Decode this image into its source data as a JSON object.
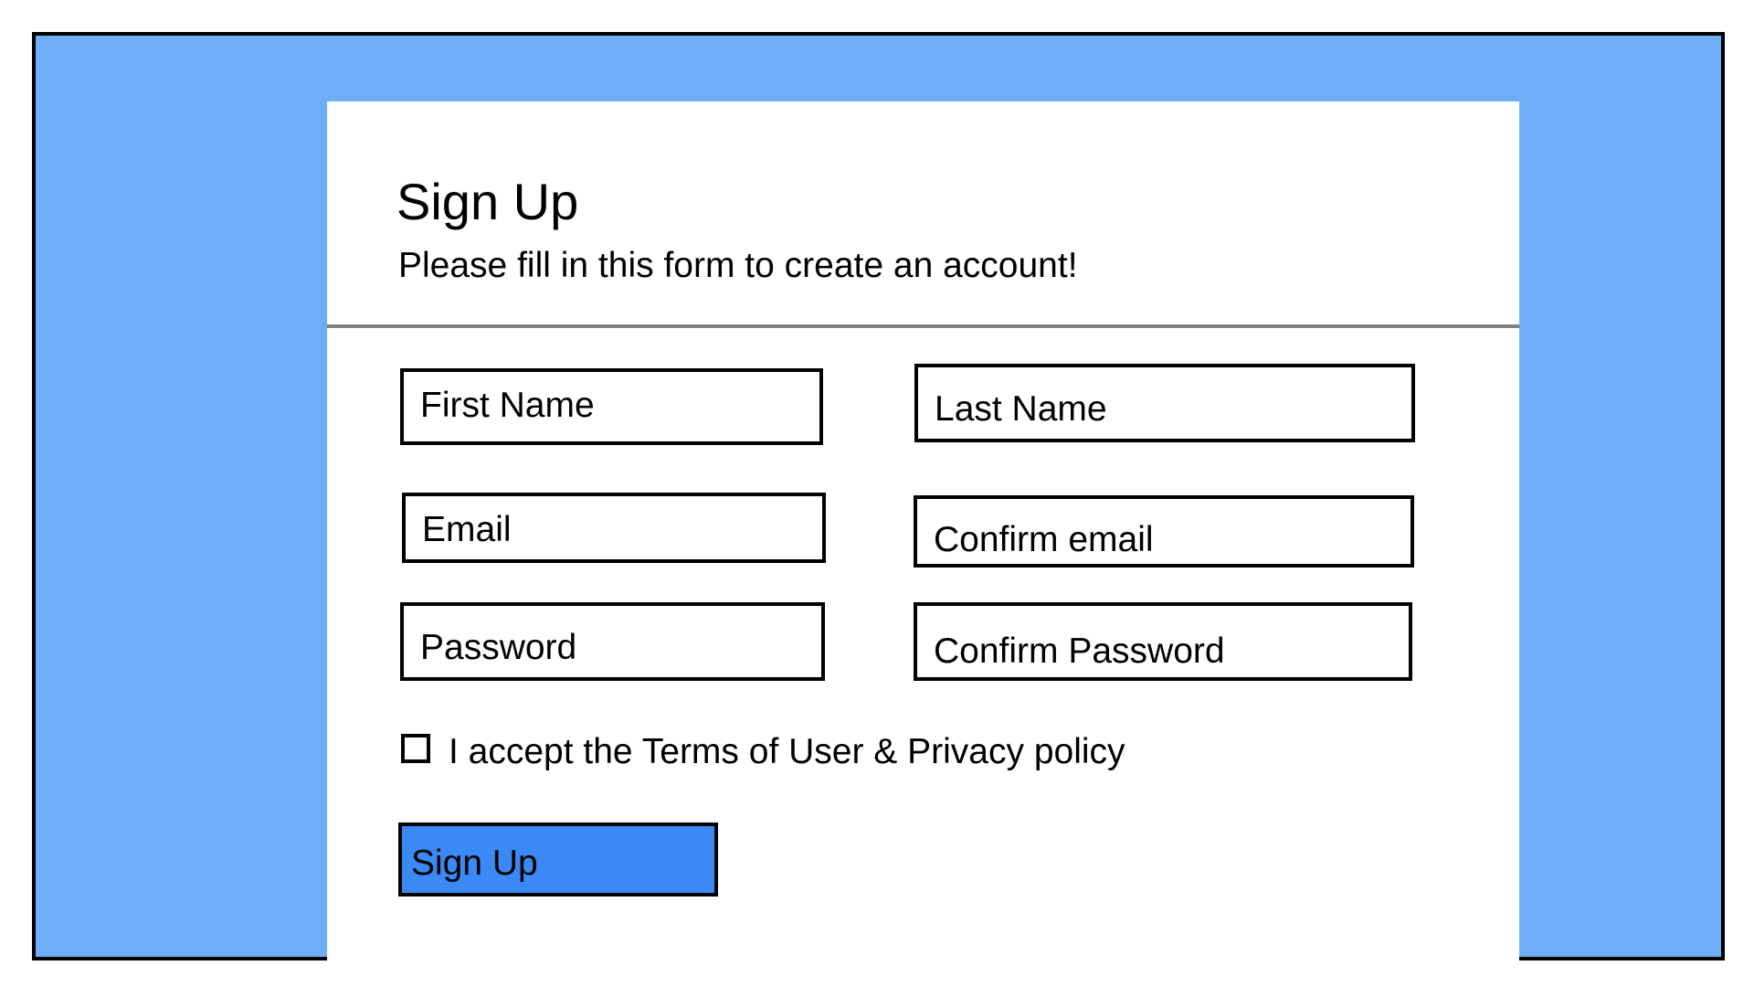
{
  "form": {
    "title": "Sign Up",
    "subtitle": "Please fill in this form to create an account!",
    "fields": {
      "first_name": "First Name",
      "last_name": "Last Name",
      "email": "Email",
      "confirm_email": "Confirm email",
      "password": "Password",
      "confirm_password": "Confirm Password"
    },
    "terms": {
      "checked": false,
      "label": "I accept the Terms of User & Privacy policy"
    },
    "submit_label": "Sign Up"
  },
  "colors": {
    "background": "#6eaef7",
    "card": "#ffffff",
    "button": "#3a89f4",
    "divider": "#7f7f7f"
  }
}
